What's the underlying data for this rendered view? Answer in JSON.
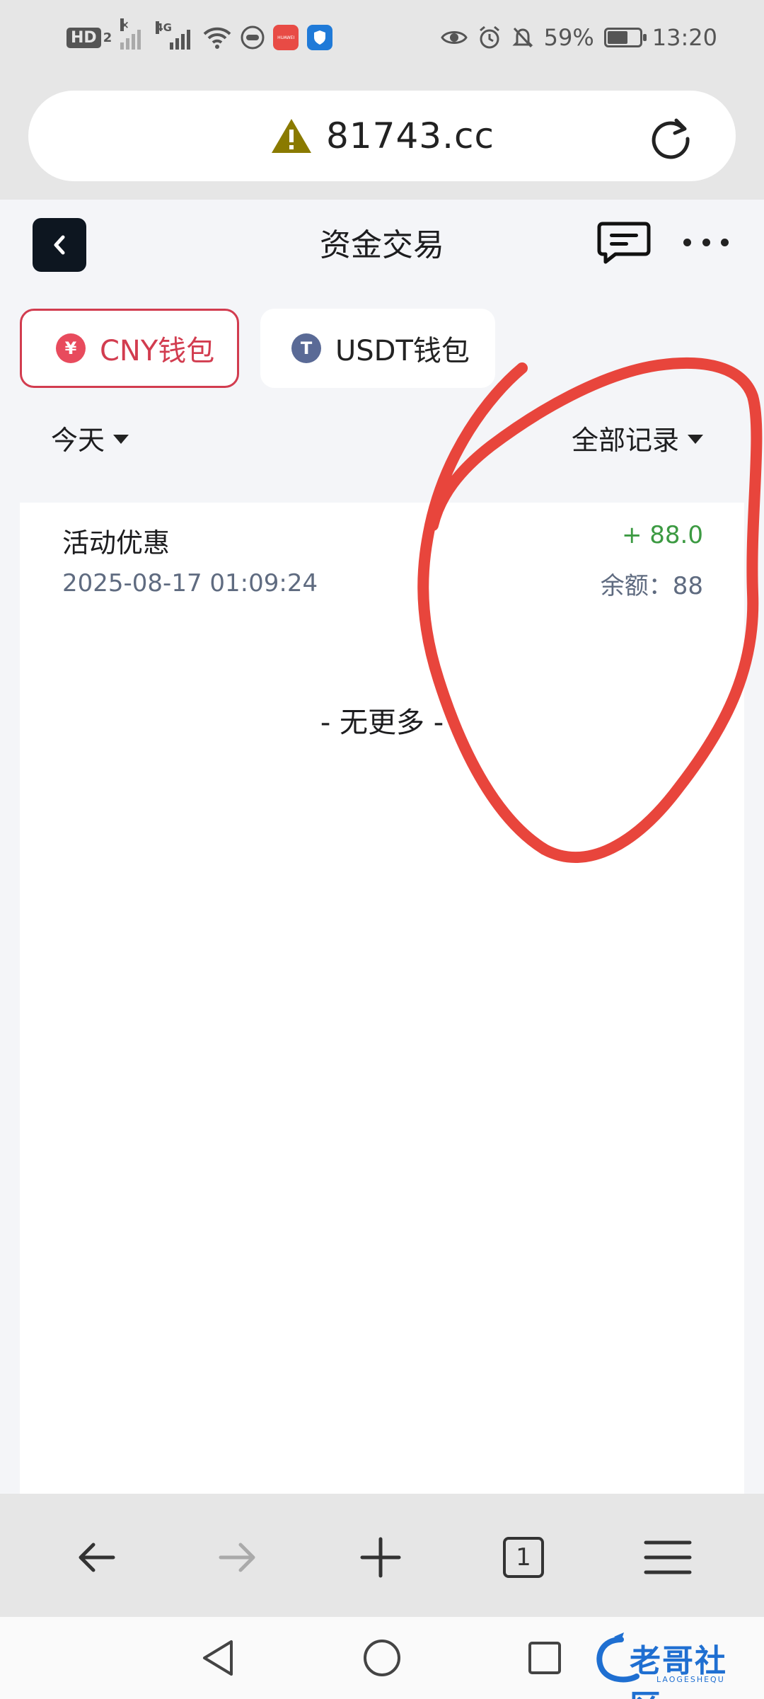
{
  "status_bar": {
    "hd_label": "HD",
    "hd_num": "2",
    "net_label": "4G",
    "battery_percent": "59%",
    "battery_level": 0.59,
    "time": "13:20",
    "app_icon_label": "HUAWEI"
  },
  "browser": {
    "url": "81743.cc",
    "warning_icon": "warning-triangle-icon",
    "tabs_count": "1"
  },
  "header": {
    "title": "资金交易"
  },
  "wallet_tabs": [
    {
      "label": "CNY钱包",
      "symbol": "¥",
      "active": true
    },
    {
      "label": "USDT钱包",
      "symbol": "T",
      "active": false
    }
  ],
  "filters": {
    "date": "今天",
    "type": "全部记录"
  },
  "transactions": [
    {
      "name": "活动优惠",
      "time": "2025-08-17 01:09:24",
      "amount": "+ 88.0",
      "balance": "余额：88"
    }
  ],
  "list_end": "- 无更多 -",
  "watermark": {
    "main": "老哥社区",
    "sub": "LAOGESHEQU"
  },
  "colors": {
    "accent": "#d23c4f",
    "positive": "#3c9a42",
    "annotation": "#e8453c"
  }
}
